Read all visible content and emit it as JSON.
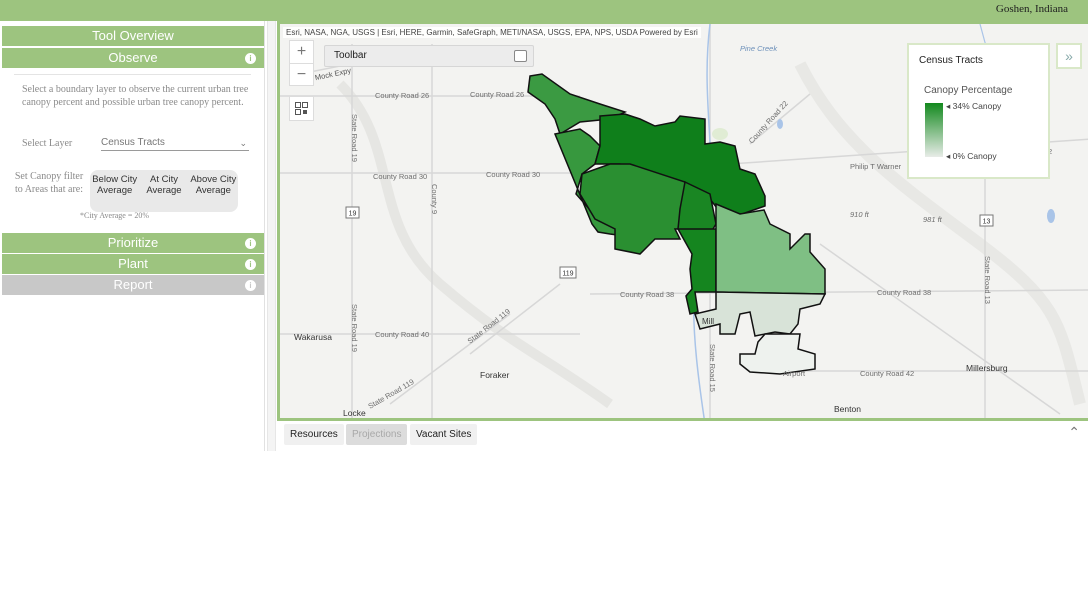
{
  "header": {
    "location": "Goshen, Indiana"
  },
  "sidebar": {
    "tool_overview": "Tool Overview",
    "observe": {
      "title": "Observe",
      "description": "Select a boundary layer to observe the current urban tree canopy percent and possible urban tree canopy percent.",
      "select_layer_label": "Select Layer",
      "select_layer_value": "Census Tracts",
      "filter_label": "Set Canopy filter to Areas that are:",
      "filter_options": [
        "Below City Average",
        "At City Average",
        "Above City Average"
      ],
      "city_average_note": "*City Average = 20%"
    },
    "prioritize": "Prioritize",
    "plant": "Plant",
    "report": "Report",
    "info_icon_text": "i"
  },
  "map": {
    "attribution": "Esri, NASA, NGA, USGS | Esri, HERE, Garmin, SafeGraph, METI/NASA, USGS, EPA, NPS, USDA   Powered by Esri",
    "toolbar_title": "Toolbar",
    "labels": {
      "county_road_26a": "County Road 26",
      "county_road_26b": "County Road 26",
      "county_road_30a": "County Road 30",
      "county_road_30b": "County Road 30",
      "county_road_38a": "County Road 38",
      "county_road_38b": "County Road 38",
      "county_road_40": "County Road 40",
      "county_road_42": "County Road 42",
      "county_road_22": "County Road 22",
      "state_road_19a": "State Road 19",
      "state_road_19b": "State Road 19",
      "state_road_119a": "State Road 119",
      "state_road_119b": "State Road 119",
      "state_road_13": "State Road 13",
      "state_road_15": "State Road 15",
      "county_9": "County 9",
      "pine_creek": "Pine Creek",
      "philip_t_warner": "Philip T Warner",
      "mock_expy": "an R Mock Expy",
      "wakarusa": "Wakarusa",
      "foraker": "Foraker",
      "millersburg": "Millersburg",
      "benton": "Benton",
      "locke": "Locke",
      "airport": "Airport",
      "mill": "Mill",
      "elev_910": "910 ft",
      "elev_981": "981 ft",
      "shield_19": "19",
      "shield_119": "119",
      "shield_13": "13",
      "edge_2": "2"
    },
    "legend": {
      "title": "Census Tracts",
      "subtitle": "Canopy Percentage",
      "high": "34% Canopy",
      "low": "0% Canopy",
      "high_color": "#13891e",
      "low_color": "#e8ece8"
    }
  },
  "bottom_tabs": {
    "resources": "Resources",
    "projections": "Projections",
    "vacant_sites": "Vacant Sites"
  },
  "colors": {
    "accent": "#9dc47f",
    "inactive": "#c8c8c8"
  }
}
